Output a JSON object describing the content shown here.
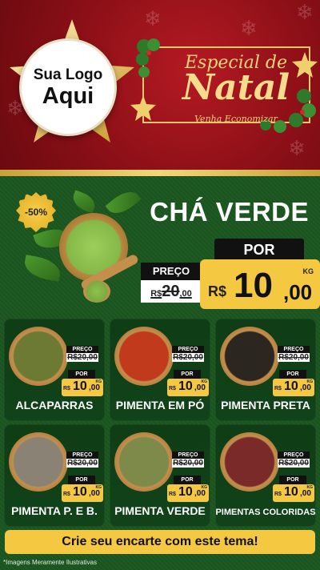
{
  "header": {
    "logo_line1": "Sua Logo",
    "logo_line2": "Aqui",
    "special_of": "Especial de",
    "natal": "Natal",
    "subtitle": "Venha Economizar"
  },
  "featured": {
    "discount": "-50%",
    "name": "CHÁ VERDE",
    "old_label": "PREÇO",
    "old_currency": "R$",
    "old_int": "20",
    "old_dec": ",00",
    "por_label": "POR",
    "currency": "R$",
    "price_int": "10",
    "price_dec": ",00",
    "unit": "KG"
  },
  "products": [
    {
      "name": "ALCAPARRAS",
      "old_label": "PREÇO",
      "old_value": "R$20,00",
      "por_label": "POR",
      "currency": "R$",
      "price_int": "10",
      "price_dec": ",00",
      "unit": "KG",
      "color": "#6d7a34"
    },
    {
      "name": "PIMENTA EM PÓ",
      "old_label": "PREÇO",
      "old_value": "R$20,00",
      "por_label": "POR",
      "currency": "R$",
      "price_int": "10",
      "price_dec": ",00",
      "unit": "KG",
      "color": "#c23a1c"
    },
    {
      "name": "PIMENTA PRETA",
      "old_label": "PREÇO",
      "old_value": "R$20,00",
      "por_label": "POR",
      "currency": "R$",
      "price_int": "10",
      "price_dec": ",00",
      "unit": "KG",
      "color": "#2b2620"
    },
    {
      "name": "PIMENTA P. E B.",
      "old_label": "PREÇO",
      "old_value": "R$20,00",
      "por_label": "POR",
      "currency": "R$",
      "price_int": "10",
      "price_dec": ",00",
      "unit": "KG",
      "color": "#8a8275"
    },
    {
      "name": "PIMENTA VERDE",
      "old_label": "PREÇO",
      "old_value": "R$20,00",
      "por_label": "POR",
      "currency": "R$",
      "price_int": "10",
      "price_dec": ",00",
      "unit": "KG",
      "color": "#7d8a4a"
    },
    {
      "name": "PIMENTAS COLORIDAS",
      "old_label": "PREÇO",
      "old_value": "R$20,00",
      "por_label": "POR",
      "currency": "R$",
      "price_int": "10",
      "price_dec": ",00",
      "unit": "KG",
      "color": "#7a2a28"
    }
  ],
  "cta": "Crie seu encarte com este tema!",
  "disclaimer": "*Imagens Meramente Ilustrativas",
  "colors": {
    "red": "#8b0f17",
    "green": "#1b5320",
    "gold": "#f5c842"
  }
}
